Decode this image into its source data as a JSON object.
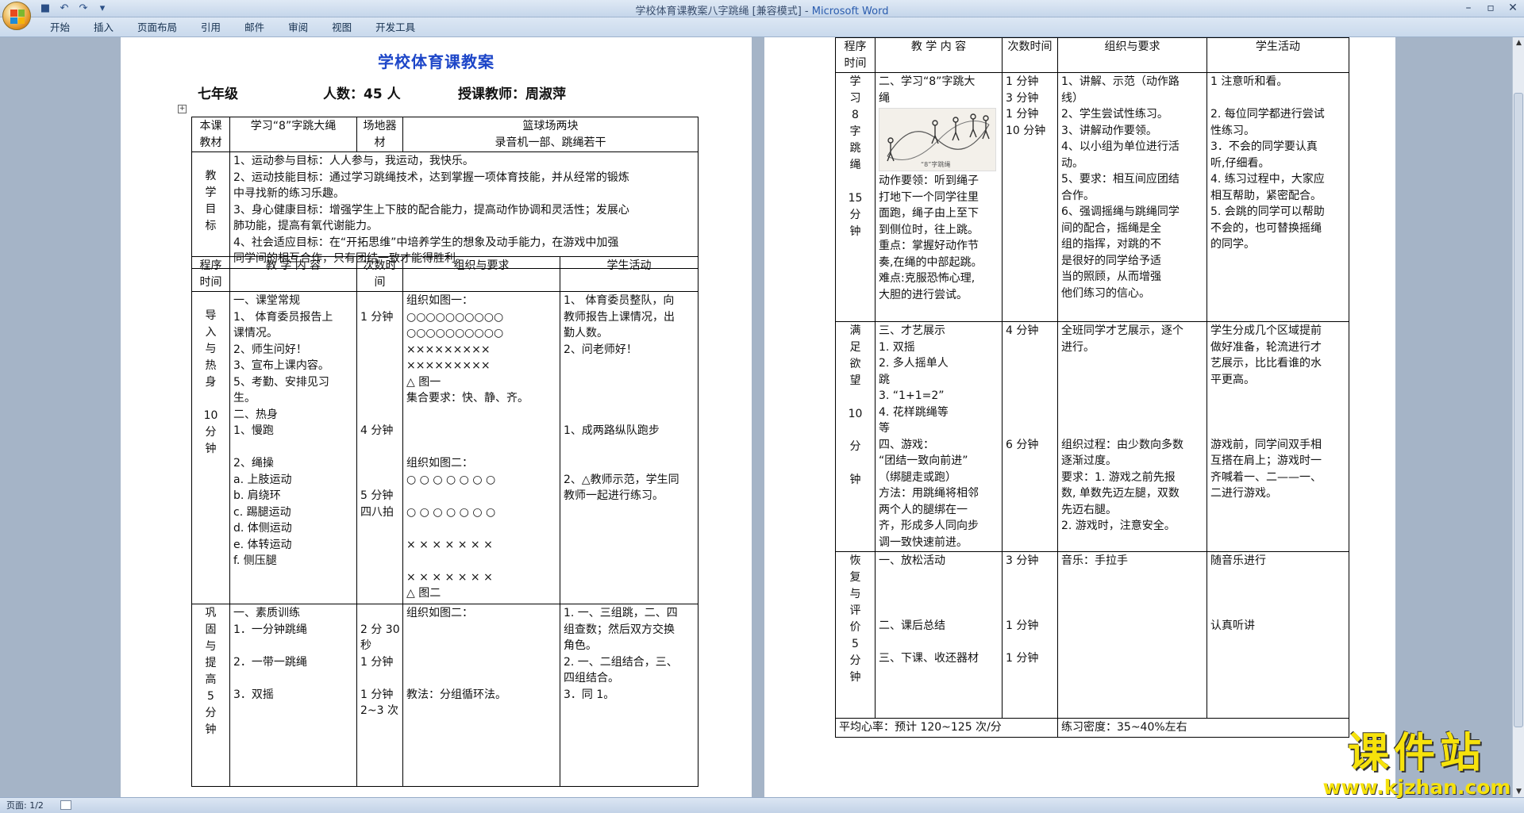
{
  "window": {
    "title": "学校体育课教案八字跳绳 [兼容模式] - ",
    "app_name": "Microsoft Word"
  },
  "qat": {
    "save_icon": "save-icon",
    "undo_icon": "undo-icon",
    "redo_icon": "redo-icon",
    "more": "▾"
  },
  "tabs": [
    "开始",
    "插入",
    "页面布局",
    "引用",
    "邮件",
    "审阅",
    "视图",
    "开发工具"
  ],
  "status": {
    "page": "页面: 1/2"
  },
  "watermark": {
    "title": "课件站",
    "url": "www.kjzhan.com"
  },
  "doc": {
    "heading": "学校体育课教案",
    "grade": "七年级",
    "count": "人数：45 人",
    "teacher": "授课教师：周淑萍",
    "table1": {
      "material_label": "本课教材",
      "material": "学习“8”字跳大绳",
      "venue_label": "场地器材",
      "venue_line1": "篮球场两块",
      "venue_line2": "录音机一部、跳绳若干",
      "goal_label": [
        "教",
        "学",
        "目",
        "标"
      ],
      "goals": [
        "1、运动参与目标：人人参与，我运动，我快乐。",
        "2、运动技能目标：通过学习跳绳技术，达到掌握一项体育技能，并从经常的锻炼",
        "中寻找新的练习乐趣。",
        "3、身心健康目标：增强学生上下肢的配合能力，提高动作协调和灵活性；发展心",
        "肺功能，提高有氧代谢能力。",
        "4、社会适应目标：在“开拓思维”中培养学生的想象及动手能力，在游戏中加强",
        "同学间的相互合作，只有团结一致才能得胜利。"
      ],
      "headers": [
        "程序时间",
        "教 学 内 容",
        "次数时间",
        "组织与要求",
        "学生活动"
      ],
      "section1": {
        "label": [
          "导",
          "入",
          "与",
          "热",
          "身",
          "",
          "10",
          "分",
          "钟"
        ],
        "content": [
          "一、课堂常规",
          "1、 体育委员报告上",
          "课情况。",
          "2、师生问好！",
          "3、宣布上课内容。",
          "5、考勤、安排见习",
          "生。",
          "二、热身",
          "1、慢跑",
          "",
          "2、绳操",
          "a. 上肢运动",
          "b. 肩绕环",
          "c. 踢腿运动",
          "d. 体侧运动",
          "e. 体转运动",
          "f. 侧压腿"
        ],
        "times": [
          "",
          "1 分钟",
          "",
          "",
          "",
          "",
          "",
          "",
          "4 分钟",
          "",
          "",
          "",
          "5 分钟",
          "四八拍"
        ],
        "org": [
          "组织如图一：",
          "○○○○○○○○○○",
          "○○○○○○○○○○",
          "×××××××××",
          "×××××××××",
          "△   图一",
          "集合要求：快、静、齐。",
          "",
          "",
          "",
          "组织如图二：",
          "○ ○ ○ ○ ○ ○ ○",
          "",
          "○ ○ ○ ○ ○ ○ ○",
          "",
          "× × × × × × ×",
          "",
          "× × × × × × ×",
          "△     图二"
        ],
        "activity": [
          "1、 体育委员整队，向",
          "教师报告上课情况，出",
          "勤人数。",
          "2、问老师好！",
          "",
          "",
          "",
          "",
          "1、成两路纵队跑步",
          "",
          "",
          "2、△教师示范，学生同",
          "教师一起进行练习。"
        ]
      },
      "section2": {
        "label": [
          "巩",
          "固",
          "与",
          "提",
          "高",
          "5",
          "分",
          "钟"
        ],
        "content": [
          "一、素质训练",
          "1．一分钟跳绳",
          "",
          "2．一带一跳绳",
          "",
          "3．双摇"
        ],
        "times": [
          "",
          "2 分 30",
          "秒",
          "1 分钟",
          "",
          "1 分钟",
          "2~3 次"
        ],
        "org": [
          "组织如图二：",
          "",
          "",
          "",
          "",
          "教法：分组循环法。"
        ],
        "activity": [
          "1. 一、三组跳，二、四",
          "组查数；然后双方交换",
          "角色。",
          "2. 一、二组结合，三、",
          "四组结合。",
          "3．同 1。"
        ]
      }
    },
    "table2": {
      "headers": [
        "程序时间",
        "教 学 内 容",
        "次数时间",
        "组织与要求",
        "学生活动"
      ],
      "section1": {
        "label": [
          "学",
          "习",
          "8",
          "字",
          "跳",
          "绳",
          "",
          "15",
          "分",
          "钟"
        ],
        "content_top": [
          "二、学习“8”字跳大",
          "绳"
        ],
        "image_caption": "“8”字跳绳",
        "content": [
          "动作要领：听到绳子",
          "打地下一个同学往里",
          "面跑，绳子由上至下",
          "到侧位时，往上跳。",
          "重点：掌握好动作节",
          "奏,在绳的中部起跳。",
          "难点:克服恐怖心理,",
          "大胆的进行尝试。"
        ],
        "times": [
          "1 分钟",
          "3 分钟",
          "1 分钟",
          "10 分钟"
        ],
        "org": [
          "1、讲解、示范（动作路",
          "线）",
          "2、学生尝试性练习。",
          "3、讲解动作要领。",
          "4、以小组为单位进行活",
          "动。",
          "5、要求：相互间应团结",
          "合作。",
          "6、强调摇绳与跳绳同学",
          "间的配合，摇绳是全",
          "组的指挥，对跳的不",
          "是很好的同学给予适",
          "当的照顾，从而增强",
          "他们练习的信心。"
        ],
        "activity": [
          "1 注意听和看。",
          "",
          "2. 每位同学都进行尝试",
          "性练习。",
          "3．不会的同学要认真",
          "听,仔细看。",
          "4. 练习过程中，大家应",
          "相互帮助，紧密配合。",
          "5. 会跳的同学可以帮助",
          "不会的，也可替换摇绳",
          "的同学。"
        ]
      },
      "section2": {
        "label": [
          "满",
          "足",
          "欲",
          "望",
          "",
          "10",
          "",
          "分",
          "",
          "钟"
        ],
        "content": [
          "三、才艺展示",
          "1. 双摇",
          "2. 多人摇单人",
          "跳",
          "3. “1+1=2”",
          "4. 花样跳绳等",
          "等",
          "四、游戏：",
          "“团结一致向前进”",
          "（绑腿走或跑）",
          "方法：用跳绳将相邻",
          "两个人的腿绑在一",
          "齐，形成多人同向步",
          "调一致快速前进。"
        ],
        "times": [
          "4 分钟",
          "",
          "",
          "",
          "",
          "",
          "",
          "6 分钟"
        ],
        "org": [
          "全班同学才艺展示，逐个",
          "进行。",
          "",
          "",
          "",
          "",
          "",
          "组织过程：由少数向多数",
          "逐渐过度。",
          "要求：1. 游戏之前先报",
          "数, 单数先迈左腿，双数",
          "先迈右腿。",
          "2. 游戏时，注意安全。"
        ],
        "activity": [
          "学生分成几个区域提前",
          "做好准备，轮流进行才",
          "艺展示，比比看谁的水",
          "平更高。",
          "",
          "",
          "",
          "游戏前，同学间双手相",
          "互搭在肩上；游戏时一",
          "齐喊着一、二——一、",
          "二进行游戏。"
        ]
      },
      "section3": {
        "label": [
          "恢",
          "复",
          "与",
          "评",
          "价",
          "5",
          "分",
          "钟"
        ],
        "content": [
          "一、放松活动",
          "",
          "",
          "",
          "二、课后总结",
          "",
          "三、下课、收还器材"
        ],
        "times": [
          "3 分钟",
          "",
          "",
          "",
          "1 分钟",
          "",
          "1 分钟"
        ],
        "org": [
          "音乐：手拉手"
        ],
        "activity": [
          "随音乐进行",
          "",
          "",
          "",
          "认真听讲"
        ]
      },
      "footer_left": "平均心率：预计 120~125 次/分",
      "footer_right": "练习密度：35~40%左右"
    }
  }
}
